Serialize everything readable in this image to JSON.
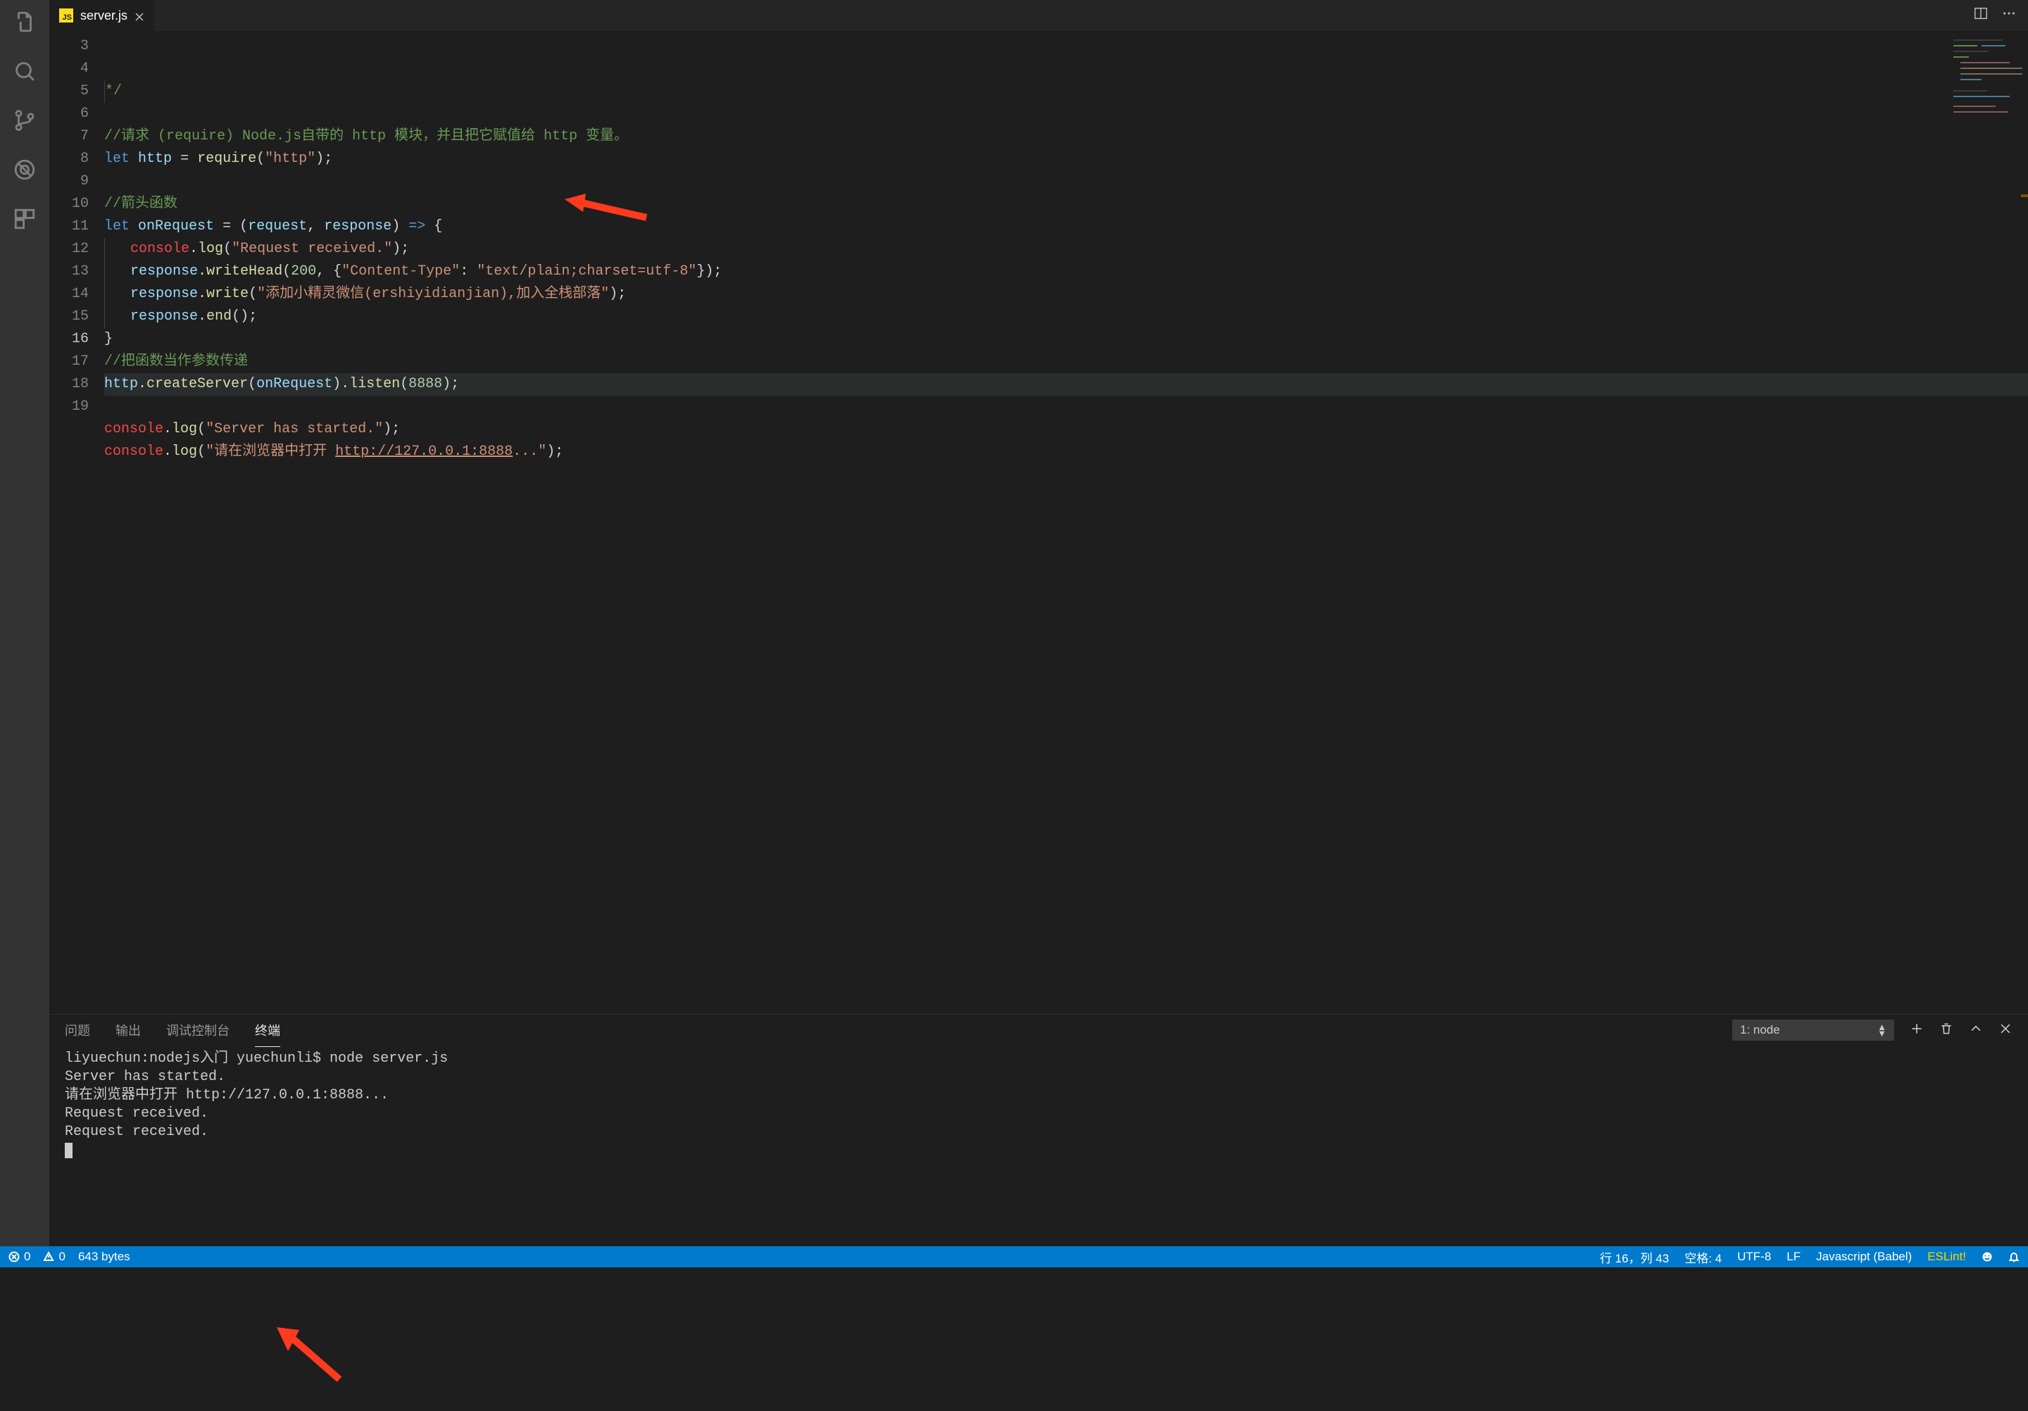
{
  "tab": {
    "filename": "server.js",
    "badge": "JS"
  },
  "code": {
    "lines": [
      {
        "n": 3,
        "html": "<span class='guide'></span><span class='c-comment'>*/</span>"
      },
      {
        "n": 4,
        "html": ""
      },
      {
        "n": 5,
        "html": "<span class='c-comment'>//请求 (require) Node.js自带的 http 模块，并且把它赋值给 http 变量。</span>"
      },
      {
        "n": 6,
        "html": "<span class='c-keyword'>let</span> <span class='c-var'>http</span> <span class='c-operator'>=</span> <span class='c-func'>require</span><span class='c-punc'>(</span><span class='c-string'>\"http\"</span><span class='c-punc'>);</span>"
      },
      {
        "n": 7,
        "html": ""
      },
      {
        "n": 8,
        "html": "<span class='c-comment'>//箭头函数</span>"
      },
      {
        "n": 9,
        "html": "<span class='c-keyword'>let</span> <span class='c-var'>onRequest</span> <span class='c-operator'>=</span> <span class='c-punc'>(</span><span class='c-var'>request</span><span class='c-punc'>,</span> <span class='c-var'>response</span><span class='c-punc'>)</span> <span class='c-keyword'>=&gt;</span> <span class='c-punc'>{</span>"
      },
      {
        "n": 10,
        "html": "<span class='guide'></span>   <span class='c-builtin'>console</span><span class='c-punc'>.</span><span class='c-func'>log</span><span class='c-punc'>(</span><span class='c-string'>\"Request received.\"</span><span class='c-punc'>);</span>"
      },
      {
        "n": 11,
        "html": "<span class='guide'></span>   <span class='c-var'>response</span><span class='c-punc'>.</span><span class='c-func'>writeHead</span><span class='c-punc'>(</span><span class='c-number'>200</span><span class='c-punc'>,</span> <span class='c-punc'>{</span><span class='c-string'>\"Content-Type\"</span><span class='c-punc'>:</span> <span class='c-string'>\"text/plain;charset=utf-8\"</span><span class='c-punc'>});</span>"
      },
      {
        "n": 12,
        "html": "<span class='guide'></span>   <span class='c-var'>response</span><span class='c-punc'>.</span><span class='c-func'>write</span><span class='c-punc'>(</span><span class='c-string'>\"添加小精灵微信(ershiyidianjian),加入全栈部落\"</span><span class='c-punc'>);</span>"
      },
      {
        "n": 13,
        "html": "<span class='guide'></span>   <span class='c-var'>response</span><span class='c-punc'>.</span><span class='c-func'>end</span><span class='c-punc'>();</span>"
      },
      {
        "n": 14,
        "html": "<span class='c-punc'>}</span>"
      },
      {
        "n": 15,
        "html": "<span class='c-comment'>//把函数当作参数传递</span>"
      },
      {
        "n": 16,
        "active": true,
        "html": "<span class='c-var'>http</span><span class='c-punc'>.</span><span class='c-func'>createServer</span><span class='c-punc'>(</span><span class='c-var'>onRequest</span><span class='c-punc'>).</span><span class='c-func'>listen</span><span class='c-punc'>(</span><span class='c-number'>8888</span><span class='c-punc'>);</span>"
      },
      {
        "n": 17,
        "html": ""
      },
      {
        "n": 18,
        "html": "<span class='c-builtin'>console</span><span class='c-punc'>.</span><span class='c-func'>log</span><span class='c-punc'>(</span><span class='c-string'>\"Server has started.\"</span><span class='c-punc'>);</span>"
      },
      {
        "n": 19,
        "html": "<span class='c-builtin'>console</span><span class='c-punc'>.</span><span class='c-func'>log</span><span class='c-punc'>(</span><span class='c-string'>\"请在浏览器中打开 <span class='c-url'>http://127.0.0.1:8888</span>...\"</span><span class='c-punc'>);</span>"
      }
    ]
  },
  "panel": {
    "tabs": {
      "problems": "问题",
      "output": "输出",
      "debugConsole": "调试控制台",
      "terminal": "终端"
    },
    "terminalSelect": "1: node",
    "terminalLines": [
      "liyuechun:nodejs入门 yuechunli$ node server.js",
      "Server has started.",
      "请在浏览器中打开 http://127.0.0.1:8888...",
      "Request received.",
      "Request received."
    ]
  },
  "status": {
    "errors": "0",
    "warnings": "0",
    "size": "643 bytes",
    "position": "行 16，列 43",
    "spaces": "空格: 4",
    "encoding": "UTF-8",
    "eol": "LF",
    "language": "Javascript (Babel)",
    "eslint": "ESLint!"
  }
}
